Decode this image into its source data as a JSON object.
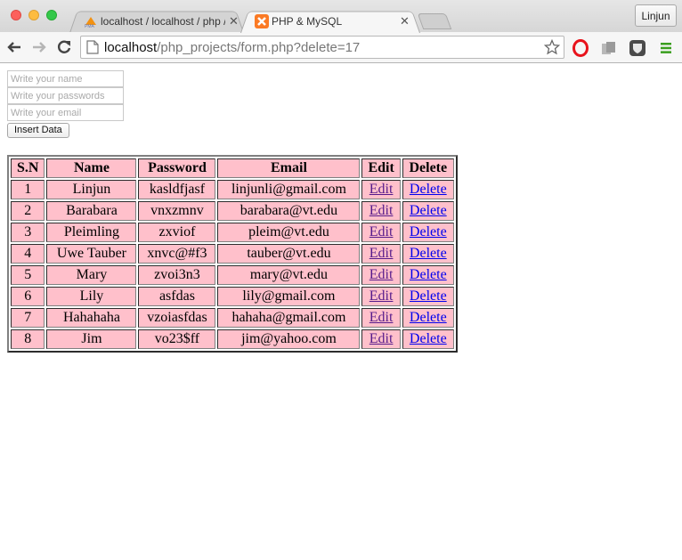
{
  "browser": {
    "tabs": [
      {
        "title": "localhost / localhost / php /",
        "active": false,
        "icon": "phpmyadmin-icon"
      },
      {
        "title": "PHP & MySQL",
        "active": true,
        "icon": "xampp-icon"
      }
    ],
    "profile_label": "Linjun",
    "url_host": "localhost",
    "url_path": "/php_projects/form.php?delete=17"
  },
  "form": {
    "name_placeholder": "Write your name",
    "password_placeholder": "Write your passwords",
    "email_placeholder": "Write your email",
    "submit_label": "Insert Data"
  },
  "table": {
    "headers": [
      "S.N",
      "Name",
      "Password",
      "Email",
      "Edit",
      "Delete"
    ],
    "edit_label": "Edit",
    "delete_label": "Delete",
    "rows": [
      {
        "sn": "1",
        "name": "Linjun",
        "password": "kasldfjasf",
        "email": "linjunli@gmail.com"
      },
      {
        "sn": "2",
        "name": "Barabara",
        "password": "vnxzmnv",
        "email": "barabara@vt.edu"
      },
      {
        "sn": "3",
        "name": "Pleimling",
        "password": "zxviof",
        "email": "pleim@vt.edu"
      },
      {
        "sn": "4",
        "name": "Uwe Tauber",
        "password": "xnvc@#f3",
        "email": "tauber@vt.edu"
      },
      {
        "sn": "5",
        "name": "Mary",
        "password": "zvoi3n3",
        "email": "mary@vt.edu"
      },
      {
        "sn": "6",
        "name": "Lily",
        "password": "asfdas",
        "email": "lily@gmail.com"
      },
      {
        "sn": "7",
        "name": "Hahahaha",
        "password": "vzoiasfdas",
        "email": "hahaha@gmail.com"
      },
      {
        "sn": "8",
        "name": "Jim",
        "password": "vo23$ff",
        "email": "jim@yahoo.com"
      }
    ]
  },
  "colors": {
    "cell_background": "#ffc0cb",
    "link": "#0000ee",
    "visited_link": "#551a8b"
  }
}
